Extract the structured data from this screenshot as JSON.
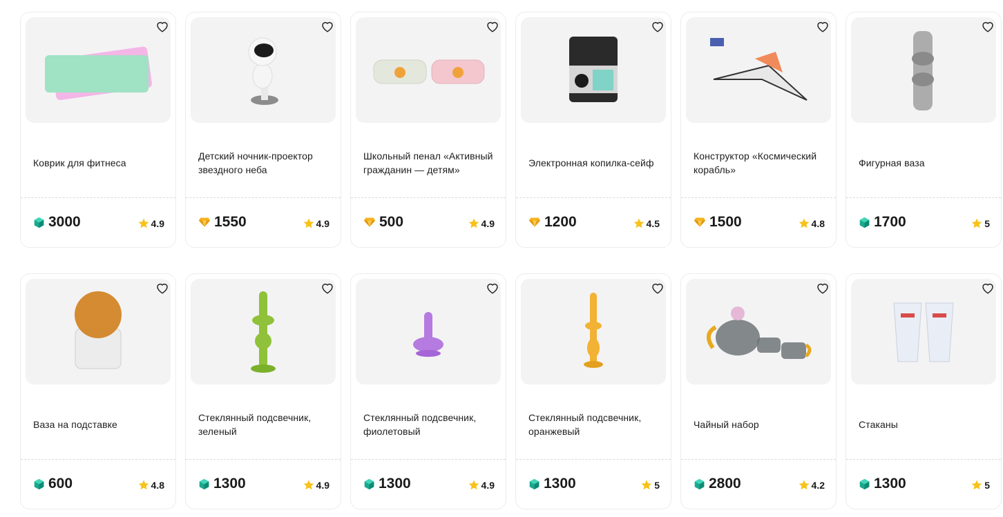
{
  "icons": {
    "favorite": "heart-outline-icon",
    "crystal_currency": "crystal-icon",
    "diamond_currency": "diamond-icon",
    "rating": "star-icon"
  },
  "colors": {
    "crystal": "#1fb59a",
    "diamond": "#f5b21c",
    "star": "#f7c21a"
  },
  "products": [
    {
      "title": "Коврик для фитнеса",
      "price": "3000",
      "currency": "crystal",
      "rating": "4.9",
      "image": "fitness-mat"
    },
    {
      "title": "Детский ночник-проектор звездного неба",
      "price": "1550",
      "currency": "diamond",
      "rating": "4.9",
      "image": "astronaut-projector"
    },
    {
      "title": "Школьный пенал «Активный гражданин — детям»",
      "price": "500",
      "currency": "diamond",
      "rating": "4.9",
      "image": "pencil-cases"
    },
    {
      "title": "Электронная копилка-сейф",
      "price": "1200",
      "currency": "diamond",
      "rating": "4.5",
      "image": "safe-bank"
    },
    {
      "title": "Конструктор «Космический корабль»",
      "price": "1500",
      "currency": "diamond",
      "rating": "4.8",
      "image": "space-ship"
    },
    {
      "title": "Фигурная ваза",
      "price": "1700",
      "currency": "crystal",
      "rating": "5",
      "image": "gray-vase"
    },
    {
      "title": "Ваза на подставке",
      "price": "600",
      "currency": "crystal",
      "rating": "4.8",
      "image": "ball-vase"
    },
    {
      "title": "Стеклянный подсвечник, зеленый",
      "price": "1300",
      "currency": "crystal",
      "rating": "4.9",
      "image": "candle-green"
    },
    {
      "title": "Стеклянный подсвечник, фиолетовый",
      "price": "1300",
      "currency": "crystal",
      "rating": "4.9",
      "image": "candle-violet"
    },
    {
      "title": "Стеклянный подсвечник, оранжевый",
      "price": "1300",
      "currency": "crystal",
      "rating": "5",
      "image": "candle-orange"
    },
    {
      "title": "Чайный набор",
      "price": "2800",
      "currency": "crystal",
      "rating": "4.2",
      "image": "tea-set"
    },
    {
      "title": "Стаканы",
      "price": "1300",
      "currency": "crystal",
      "rating": "5",
      "image": "glasses"
    }
  ]
}
